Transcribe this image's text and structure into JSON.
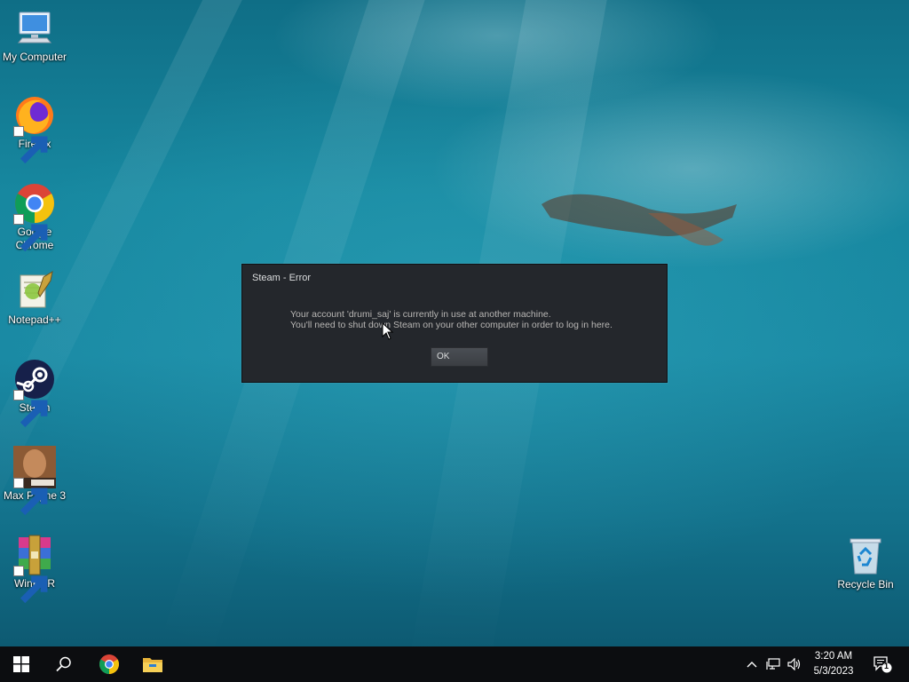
{
  "desktop": {
    "icons": [
      {
        "label": "My Computer",
        "icon": "my-computer-icon"
      },
      {
        "label": "Firefox",
        "icon": "firefox-icon"
      },
      {
        "label": "Google Chrome",
        "icon": "chrome-icon"
      },
      {
        "label": "Notepad++",
        "icon": "notepadpp-icon"
      },
      {
        "label": "Steam",
        "icon": "steam-icon"
      },
      {
        "label": "Max Payne 3",
        "icon": "max-payne-3-icon"
      },
      {
        "label": "WinRAR",
        "icon": "winrar-icon"
      },
      {
        "label": "Recycle Bin",
        "icon": "recycle-bin-icon"
      }
    ]
  },
  "dialog": {
    "title": "Steam - Error",
    "message_line1": "Your account 'drumi_saj' is currently in use at another machine.",
    "message_line2": "You'll need to shut down Steam on your other computer in order to log in here.",
    "ok_label": "OK",
    "bg_color": "#24272c"
  },
  "taskbar": {
    "pinned": [
      "start-icon",
      "search-icon",
      "chrome-icon",
      "file-explorer-icon"
    ],
    "tray": [
      "chevron-up-icon",
      "network-icon",
      "volume-icon"
    ],
    "time": "3:20 AM",
    "date": "5/3/2023",
    "notification_count": "1"
  }
}
